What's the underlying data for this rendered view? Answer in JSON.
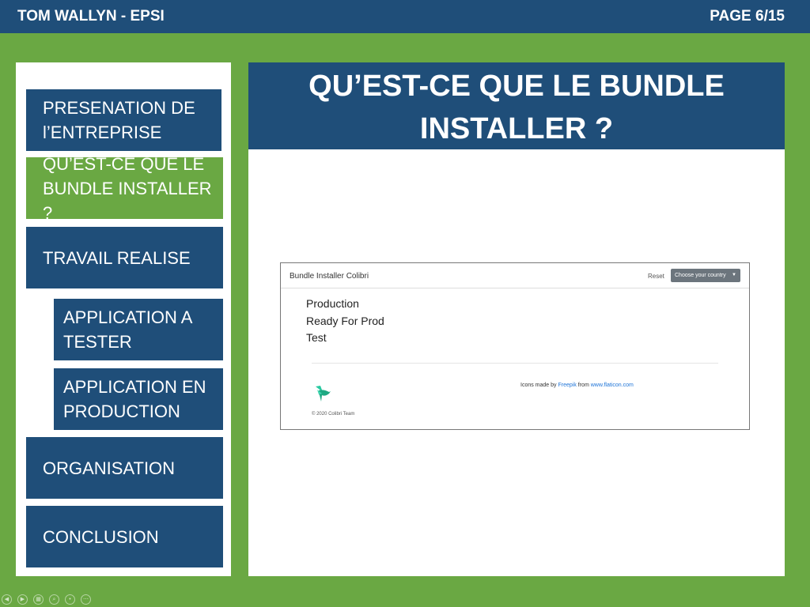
{
  "header": {
    "author": "TOM WALLYN - EPSI",
    "page": "PAGE 6/15"
  },
  "nav": [
    {
      "label": "PRESENATION DE l’ENTREPRISE"
    },
    {
      "label": "QU’EST-CE QUE LE BUNDLE INSTALLER ?",
      "active": true
    },
    {
      "label": "TRAVAIL REALISE"
    },
    {
      "label": "APPLICATION A TESTER"
    },
    {
      "label": "APPLICATION EN PRODUCTION"
    },
    {
      "label": "ORGANISATION"
    },
    {
      "label": "CONCLUSION"
    }
  ],
  "slide": {
    "title": "QU’EST-CE QUE LE BUNDLE INSTALLER ?"
  },
  "screenshot": {
    "brand": "Bundle Installer Colibri",
    "reset_label": "Reset",
    "country_select": "Choose your country",
    "items": [
      "Production",
      "Ready For Prod",
      "Test"
    ],
    "credit_prefix": "Icons made by",
    "credit_author": "Freepik",
    "credit_mid": "from",
    "credit_site": "www.flaticon.com",
    "copyright": "© 2020 Colibri Team"
  },
  "player_controls": [
    "previous-icon",
    "next-icon",
    "slides-icon",
    "zoom-icon",
    "pointer-icon",
    "more-icon"
  ],
  "colors": {
    "navy": "#1f4e79",
    "green": "#6aa843",
    "link": "#1e74d8"
  }
}
